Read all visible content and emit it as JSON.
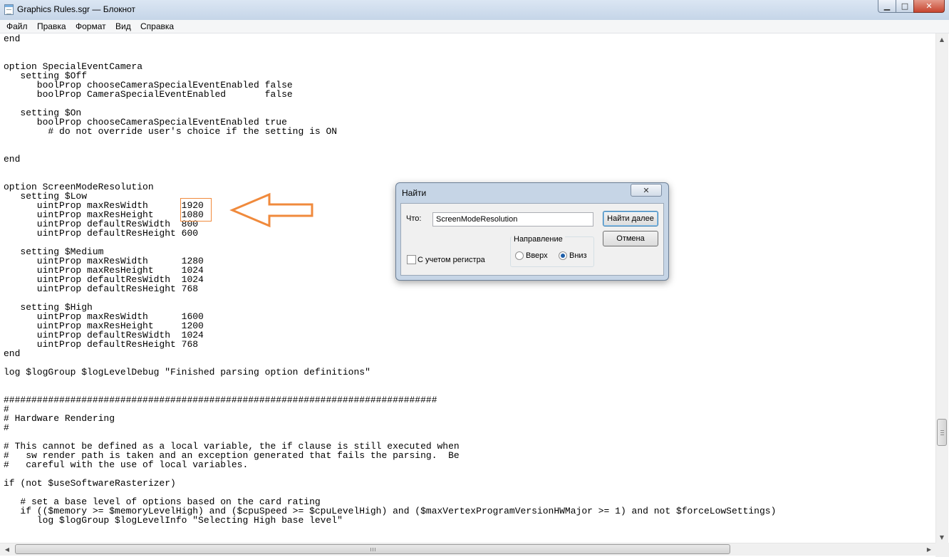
{
  "window": {
    "title": "Graphics Rules.sgr — Блокнот",
    "minimize": "▁",
    "maximize": "□",
    "close": "✕"
  },
  "menu": {
    "items": [
      {
        "label": "Файл",
        "name": "file"
      },
      {
        "label": "Правка",
        "name": "edit"
      },
      {
        "label": "Формат",
        "name": "format"
      },
      {
        "label": "Вид",
        "name": "view"
      },
      {
        "label": "Справка",
        "name": "help"
      }
    ]
  },
  "editor": {
    "text": "end\n\n\noption SpecialEventCamera\n   setting $Off\n      boolProp chooseCameraSpecialEventEnabled false\n      boolProp CameraSpecialEventEnabled       false\n\n   setting $On\n      boolProp chooseCameraSpecialEventEnabled true\n        # do not override user's choice if the setting is ON\n\n\nend\n\n\noption ScreenModeResolution\n   setting $Low\n      uintProp maxResWidth      1920\n      uintProp maxResHeight     1080\n      uintProp defaultResWidth  800\n      uintProp defaultResHeight 600\n\n   setting $Medium\n      uintProp maxResWidth      1280\n      uintProp maxResHeight     1024\n      uintProp defaultResWidth  1024\n      uintProp defaultResHeight 768\n\n   setting $High\n      uintProp maxResWidth      1600\n      uintProp maxResHeight     1200\n      uintProp defaultResWidth  1024\n      uintProp defaultResHeight 768\nend\n\nlog $logGroup $logLevelDebug \"Finished parsing option definitions\"\n\n\n##############################################################################\n#\n# Hardware Rendering\n#\n\n# This cannot be defined as a local variable, the if clause is still executed when\n#   sw render path is taken and an exception generated that fails the parsing.  Be\n#   careful with the use of local variables.\n\nif (not $useSoftwareRasterizer)\n\n   # set a base level of options based on the card rating\n   if (($memory >= $memoryLevelHigh) and ($cpuSpeed >= $cpuLevelHigh) and ($maxVertexProgramVersionHWMajor >= 1) and not $forceLowSettings)\n      log $logGroup $logLevelInfo \"Selecting High base level\""
  },
  "find_dialog": {
    "title": "Найти",
    "close": "✕",
    "what_label": "Что:",
    "what_value": "ScreenModeResolution",
    "find_next": "Найти далее",
    "cancel": "Отмена",
    "direction_label": "Направление",
    "up_label": "Вверх",
    "down_label": "Вниз",
    "direction_selected": "down",
    "match_case_label": "С учетом регистра",
    "match_case_checked": false
  },
  "annotation": {
    "color": "#f08a3c"
  }
}
